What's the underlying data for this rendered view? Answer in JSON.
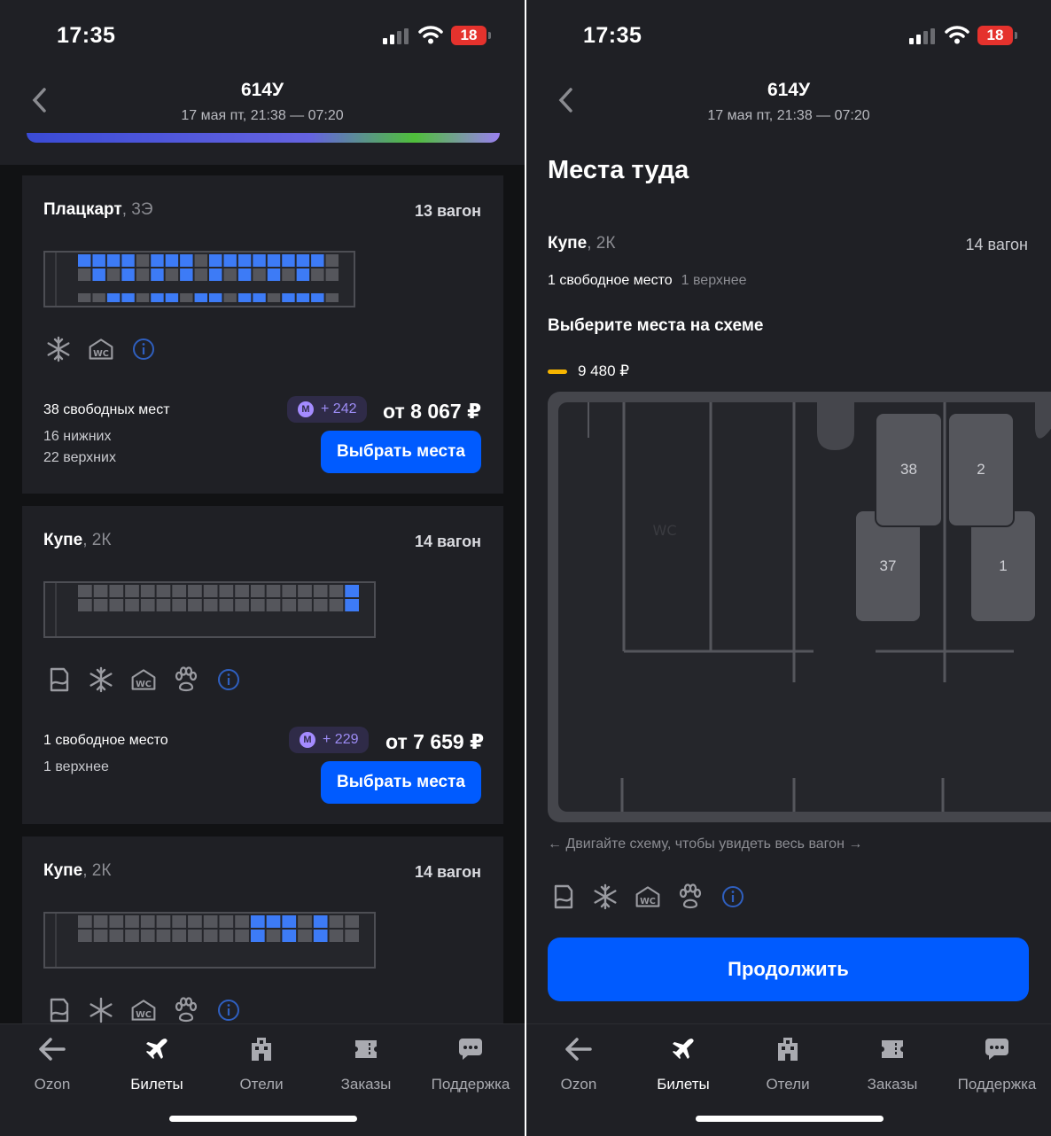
{
  "status": {
    "time": "17:35",
    "battery": "18"
  },
  "nav": {
    "train": "614У",
    "dates": "17 мая пт, 21:38 — 07:20"
  },
  "left": {
    "cards": [
      {
        "type": "Плацкарт",
        "cls": ", 3Э",
        "wagon": "13 вагон",
        "seats_main": "38 свободных мест",
        "seats_sub1": "16 нижних",
        "seats_sub2": "22 верхних",
        "bonus": "+ 242",
        "price": "от 8 067 ₽",
        "button": "Выбрать места"
      },
      {
        "type": "Купе",
        "cls": ", 2К",
        "wagon": "14 вагон",
        "seats_main": "1 свободное место",
        "seats_sub1": "1 верхнее",
        "bonus": "+ 229",
        "price": "от 7 659 ₽",
        "button": "Выбрать места"
      },
      {
        "type": "Купе",
        "cls": ", 2К",
        "wagon": "14 вагон"
      }
    ]
  },
  "right": {
    "heading": "Места туда",
    "type": "Купе",
    "cls": ", 2К",
    "wagon": "14 вагон",
    "seats": "1 свободное место",
    "seats_sub": "1 верхнее",
    "choose": "Выберите места на схеме",
    "legend_price": "9 480 ₽",
    "map_wc": "WC",
    "seats_map": [
      "38",
      "2",
      "37",
      "1"
    ],
    "hint": "← Двигайте схему, чтобы увидеть весь вагон →",
    "continue": "Продолжить"
  },
  "tabs": [
    {
      "label": "Ozon",
      "icon": "back-arrow-icon"
    },
    {
      "label": "Билеты",
      "icon": "plane-icon",
      "active": true
    },
    {
      "label": "Отели",
      "icon": "hotel-icon"
    },
    {
      "label": "Заказы",
      "icon": "ticket-icon"
    },
    {
      "label": "Поддержка",
      "icon": "chat-icon"
    }
  ],
  "colors": {
    "accent": "#005bff",
    "bonus": "#a48bff",
    "seat_free": "#3d7bf6",
    "legend": "#f7b500"
  }
}
